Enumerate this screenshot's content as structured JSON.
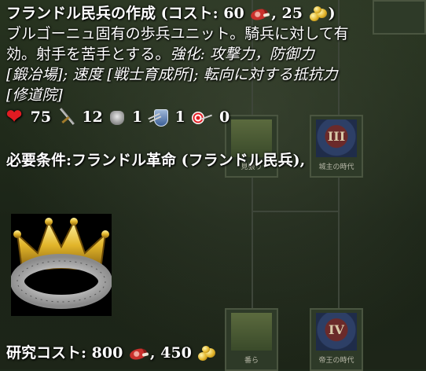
{
  "tooltip": {
    "title": "フランドル民兵の作成 (コスト: 60",
    "title_sep": ", 25",
    "title_close": ")",
    "desc_line1": "ブルゴーニュ固有の歩兵ユニット。騎兵に対して有",
    "desc_line2_a": "効。射手を苦手とする。",
    "desc_line2_b": "強化: 攻撃力，防御力",
    "upg_line3": "[鍛冶場]; 速度 [戦士育成所]; 転向に対する抵抗力",
    "upg_line4": "[修道院]",
    "stats": {
      "hp": "75",
      "attack": "12",
      "melee_armor": "1",
      "pierce_armor": "1",
      "range": "0"
    },
    "requirement": "必要条件:フランドル革命 (フランドル民兵),",
    "research_cost_label": "研究コスト: 800",
    "research_cost_gold": ", 450"
  },
  "background_tree": {
    "node_top_left_caption": "見張り",
    "node_top_right_caption": "城主の時代",
    "node_top_right_roman": "III",
    "node_bottom_left_caption": "番ら",
    "node_bottom_right_caption": "帝王の時代",
    "node_bottom_right_roman": "IV"
  },
  "icons": [
    "meat-icon",
    "gold-icon",
    "heart-icon",
    "sword-icon",
    "armor-icon",
    "pierce-armor-icon",
    "range-icon",
    "crown-icon"
  ],
  "colors": {
    "text": "#ffffff",
    "heart": "#e11b22",
    "gold": "#e2b52a",
    "background": "#1f2a1c"
  }
}
